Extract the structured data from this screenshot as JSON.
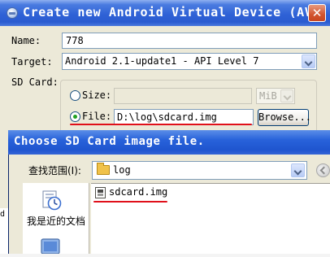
{
  "avd_dialog": {
    "title": "Create new Android Virtual Device (AVD)",
    "close_icon": "close-icon",
    "name_label": "Name:",
    "name_value": "778",
    "target_label": "Target:",
    "target_value": "Android 2.1-update1 - API Level 7",
    "sdcard_label": "SD Card:",
    "size_option_label": "Size:",
    "size_value": "",
    "size_unit": "MiB",
    "file_option_label": "File:",
    "file_value": "D:\\log\\sdcard.img",
    "browse_label": "Browse...",
    "selected_option": "file"
  },
  "file_chooser": {
    "title": "Choose SD Card image file.",
    "lookin_label": "查找范围(I):",
    "lookin_value": "log",
    "places": [
      {
        "label": "我是近的文档",
        "icon": "recent-documents-icon"
      },
      {
        "label": "",
        "icon": "desktop-icon"
      }
    ],
    "files": [
      {
        "name": "sdcard.img",
        "icon": "file-icon"
      }
    ]
  },
  "edge_sliver_text": "d",
  "colors": {
    "annotation_red": "#e0101a",
    "titlebar_blue": "#2a5bd0",
    "dialog_bg": "#ece9d8"
  }
}
